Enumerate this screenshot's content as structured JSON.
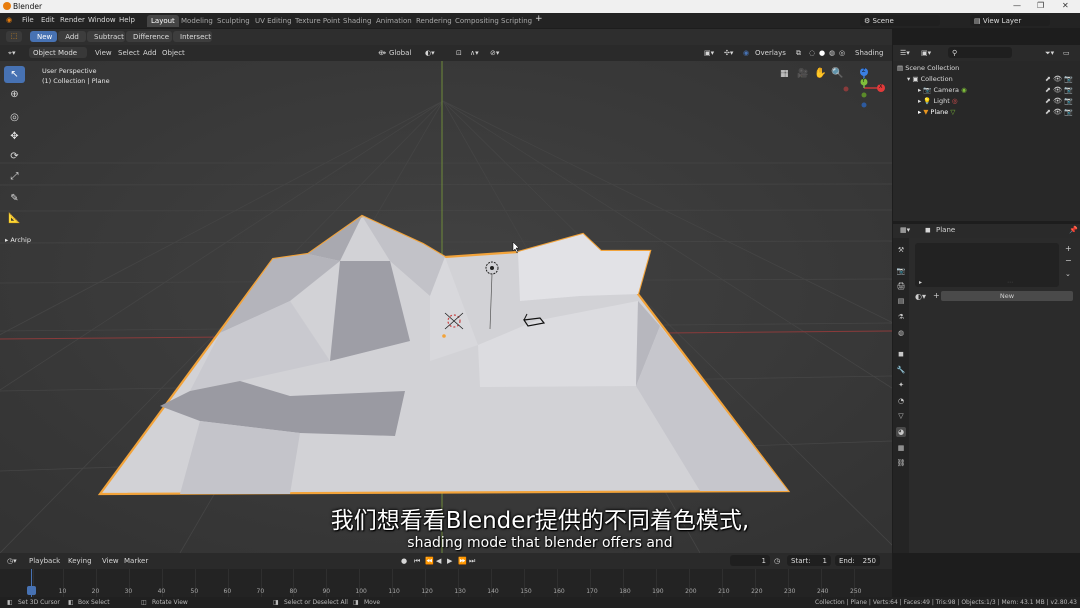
{
  "app": {
    "title": "Blender"
  },
  "menu": [
    "File",
    "Edit",
    "Render",
    "Window",
    "Help"
  ],
  "workspaces": [
    "Layout",
    "Modeling",
    "Sculpting",
    "UV Editing",
    "Texture Point",
    "Shading",
    "Animation",
    "Rendering",
    "Compositing",
    "Scripting"
  ],
  "active_workspace": "Layout",
  "scene": {
    "scene_name": "Scene",
    "view_layer": "View Layer"
  },
  "tool_header": {
    "modes": [
      "New",
      "Add",
      "Subtract",
      "Difference",
      "Intersect"
    ],
    "active": "New"
  },
  "view_header": {
    "mode": "Object Mode",
    "menus": [
      "View",
      "Select",
      "Add",
      "Object"
    ],
    "transform": "Global",
    "overlays": "Overlays",
    "shading": "Shading"
  },
  "viewport": {
    "perspective": "User Perspective",
    "collection": "(1) Collection | Plane",
    "panel_label": "Archip"
  },
  "gizmo": {
    "x": "X",
    "y": "Y",
    "z": "Z"
  },
  "outliner": {
    "root": "Scene Collection",
    "items": [
      {
        "name": "Collection",
        "level": 1
      },
      {
        "name": "Camera",
        "level": 2
      },
      {
        "name": "Light",
        "level": 2
      },
      {
        "name": "Plane",
        "level": 2
      }
    ]
  },
  "properties": {
    "object_name": "Plane",
    "new_button": "New"
  },
  "timeline": {
    "menus": [
      "Playback",
      "Keying",
      "View",
      "Marker"
    ],
    "current_frame": "1",
    "start_label": "Start:",
    "start": "1",
    "end_label": "End:",
    "end": "250",
    "ticks": [
      "1",
      "10",
      "20",
      "30",
      "40",
      "50",
      "60",
      "70",
      "80",
      "90",
      "100",
      "110",
      "120",
      "130",
      "140",
      "150",
      "160",
      "170",
      "180",
      "190",
      "200",
      "210",
      "220",
      "230",
      "240",
      "250"
    ]
  },
  "statusbar": {
    "left": [
      "Set 3D Cursor",
      "Box Select",
      "Rotate View",
      "Select or Deselect All",
      "Move"
    ],
    "right": "Collection | Plane | Verts:64 | Faces:49 | Tris:98 | Objects:1/3 | Mem: 43.1 MB | v2.80.43"
  },
  "subtitles": {
    "zh": "我们想看看Blender提供的不同着色模式,",
    "en": "shading mode that blender offers and"
  },
  "colors": {
    "accent": "#4772b3",
    "selection": "#e8951f",
    "x_axis": "#e23a3a",
    "y_axis": "#7fbf3a",
    "z_axis": "#3a7fe2"
  }
}
